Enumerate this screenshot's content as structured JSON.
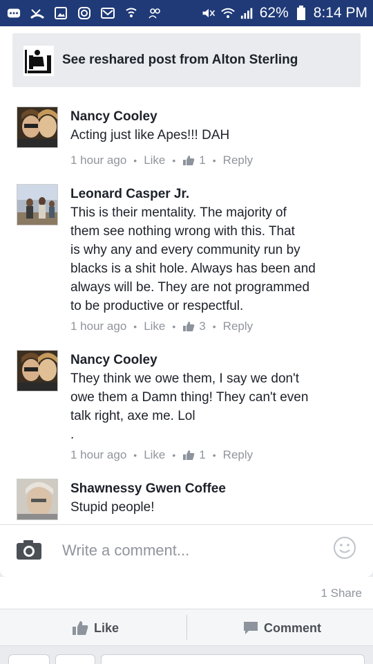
{
  "status_bar": {
    "battery": "62%",
    "time": "8:14 PM"
  },
  "reshare": {
    "text": "See reshared post from Alton Sterling"
  },
  "comments": [
    {
      "author": "Nancy Cooley",
      "text": "Acting just like Apes!!! DAH",
      "time": "1 hour ago",
      "like_label": "Like",
      "likes": "1",
      "reply_label": "Reply"
    },
    {
      "author": "Leonard Casper Jr.",
      "lines": [
        "This is their mentality. The majority of",
        "them see nothing wrong with this. That",
        "is why any and every community run by",
        "blacks is a shit hole. Always has been and",
        "always will be. They are not programmed",
        "to be productive or respectful."
      ],
      "time": "1 hour ago",
      "like_label": "Like",
      "likes": "3",
      "reply_label": "Reply"
    },
    {
      "author": "Nancy Cooley",
      "lines": [
        "They think we owe them, I say we don't",
        "owe them a Damn thing! They can't even",
        "talk right, axe me. Lol",
        "."
      ],
      "time": "1 hour ago",
      "like_label": "Like",
      "likes": "1",
      "reply_label": "Reply"
    },
    {
      "author": "Shawnessy Gwen Coffee",
      "text": "Stupid people!"
    }
  ],
  "composer": {
    "placeholder": "Write a comment..."
  },
  "post_stats": {
    "shares": "1 Share"
  },
  "actions": {
    "like": "Like",
    "comment": "Comment"
  }
}
